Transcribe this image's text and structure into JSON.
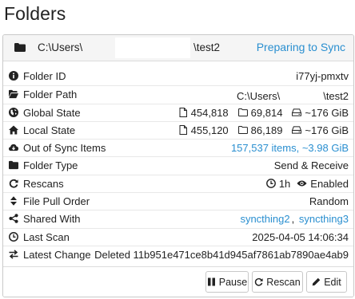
{
  "page": {
    "title": "Folders"
  },
  "folder": {
    "path_left": "C:\\Users\\",
    "path_right": "\\test2",
    "status": "Preparing to Sync"
  },
  "rows": [
    {
      "label": "Folder ID",
      "icon": "info-circle-icon",
      "value": "i77yj-pmxtv"
    },
    {
      "label": "Folder Path",
      "icon": "folder-open-icon",
      "value_left": "C:\\Users\\",
      "value_right": "\\test2"
    },
    {
      "label": "Global State",
      "icon": "globe-icon",
      "files": "454,818",
      "dirs": "69,814",
      "size": "~176 GiB"
    },
    {
      "label": "Local State",
      "icon": "home-icon",
      "files": "455,120",
      "dirs": "86,189",
      "size": "~176 GiB"
    },
    {
      "label": "Out of Sync Items",
      "icon": "cloud-download-icon",
      "value": "157,537 items, ~3.98 GiB"
    },
    {
      "label": "Folder Type",
      "icon": "folder-icon",
      "value": "Send & Receive"
    },
    {
      "label": "Rescans",
      "icon": "refresh-icon",
      "interval": "1h",
      "watch": "Enabled"
    },
    {
      "label": "File Pull Order",
      "icon": "sort-icon",
      "value": "Random"
    },
    {
      "label": "Shared With",
      "icon": "share-icon",
      "devices": [
        "syncthing2",
        "syncthing3"
      ],
      "separator": ", "
    },
    {
      "label": "Last Scan",
      "icon": "clock-icon",
      "value": "2025-04-05 14:06:34"
    },
    {
      "label": "Latest Change",
      "icon": "exchange-icon",
      "value": "Deleted 11b951e471ce8b41d945af7861ab7890ae4ab9"
    }
  ],
  "buttons": {
    "pause": "Pause",
    "rescan": "Rescan",
    "edit": "Edit"
  },
  "colors": {
    "link": "#2a8fd0",
    "text": "#222222",
    "header_bg": "#f5f5f5"
  }
}
